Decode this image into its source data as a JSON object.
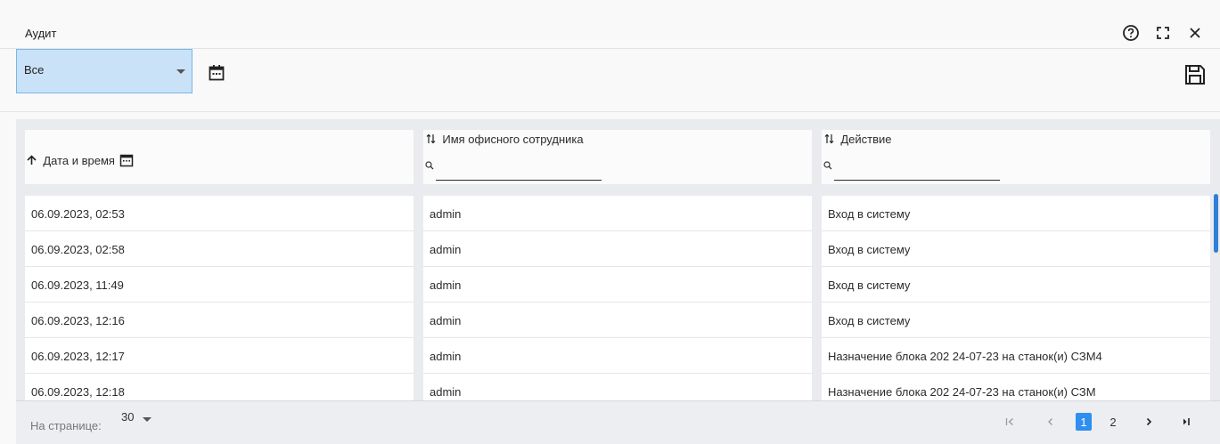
{
  "window": {
    "title": "Аудит",
    "icons": [
      "help-icon",
      "fullscreen-icon",
      "close-icon"
    ]
  },
  "toolbar": {
    "filter_select": {
      "value": "Все"
    },
    "date_icon": "calendar-icon",
    "save_icon": "save-icon"
  },
  "table": {
    "columns": [
      {
        "label": "Дата и время",
        "sort": "asc",
        "icon": "calendar-icon"
      },
      {
        "label": "Имя офисного сотрудника",
        "sort": "none",
        "filter_placeholder": ""
      },
      {
        "label": "Действие",
        "sort": "none",
        "filter_placeholder": ""
      }
    ],
    "rows": [
      {
        "datetime": "06.09.2023, 02:53",
        "user": "admin",
        "action": "Вход в систему"
      },
      {
        "datetime": "06.09.2023, 02:58",
        "user": "admin",
        "action": "Вход в систему"
      },
      {
        "datetime": "06.09.2023, 11:49",
        "user": "admin",
        "action": "Вход в систему"
      },
      {
        "datetime": "06.09.2023, 12:16",
        "user": "admin",
        "action": "Вход в систему"
      },
      {
        "datetime": "06.09.2023, 12:17",
        "user": "admin",
        "action": "Назначение блока 202 24-07-23 на станок(и) СЗМ4"
      },
      {
        "datetime": "06.09.2023, 12:18",
        "user": "admin",
        "action": "Назначение блока 202 24-07-23 на станок(и) СЗМ"
      }
    ]
  },
  "pagination": {
    "per_page_label": "На странице:",
    "per_page_value": "30",
    "pages": [
      "1",
      "2"
    ],
    "current_page": "1"
  },
  "colors": {
    "accent": "#2f8ef0",
    "select_bg": "#c9e2f7",
    "select_border": "#7ab6e8"
  }
}
